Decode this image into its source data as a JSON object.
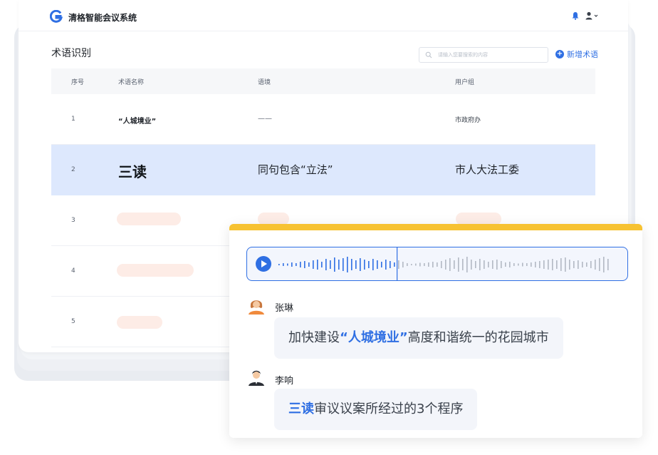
{
  "app": {
    "title": "清格智能会议系统"
  },
  "header": {
    "bell_icon": "bell-icon",
    "user_icon": "user-icon"
  },
  "page": {
    "title": "术语识别"
  },
  "search": {
    "placeholder": "请输入您要搜索的内容"
  },
  "toolbar": {
    "add_label": "新增术语"
  },
  "table": {
    "columns": [
      "序号",
      "术语名称",
      "语境",
      "用户组"
    ],
    "rows": [
      {
        "no": "1",
        "term": "“人城境业”",
        "context": "——",
        "group": "市政府办"
      },
      {
        "no": "2",
        "term": "三读",
        "context": "同句包含“立法”",
        "group": "市人大法工委"
      },
      {
        "no": "3",
        "term": "",
        "context": "",
        "group": ""
      },
      {
        "no": "4",
        "term": "",
        "context": "",
        "group": ""
      },
      {
        "no": "5",
        "term": "",
        "context": "",
        "group": ""
      }
    ]
  },
  "chat": {
    "messages": [
      {
        "speaker": "张琳",
        "before": "加快建设",
        "keyword": "“人城境业”",
        "after": "高度和谐统一的花园城市"
      },
      {
        "speaker": "李响",
        "before": "",
        "keyword": "三读",
        "after": "审议议案所经过的3个程序"
      }
    ]
  },
  "colors": {
    "accent": "#2f6fe3",
    "highlight_row": "#dde8fd",
    "card_top": "#f7c231",
    "placeholder_pill": "#fdece6"
  }
}
